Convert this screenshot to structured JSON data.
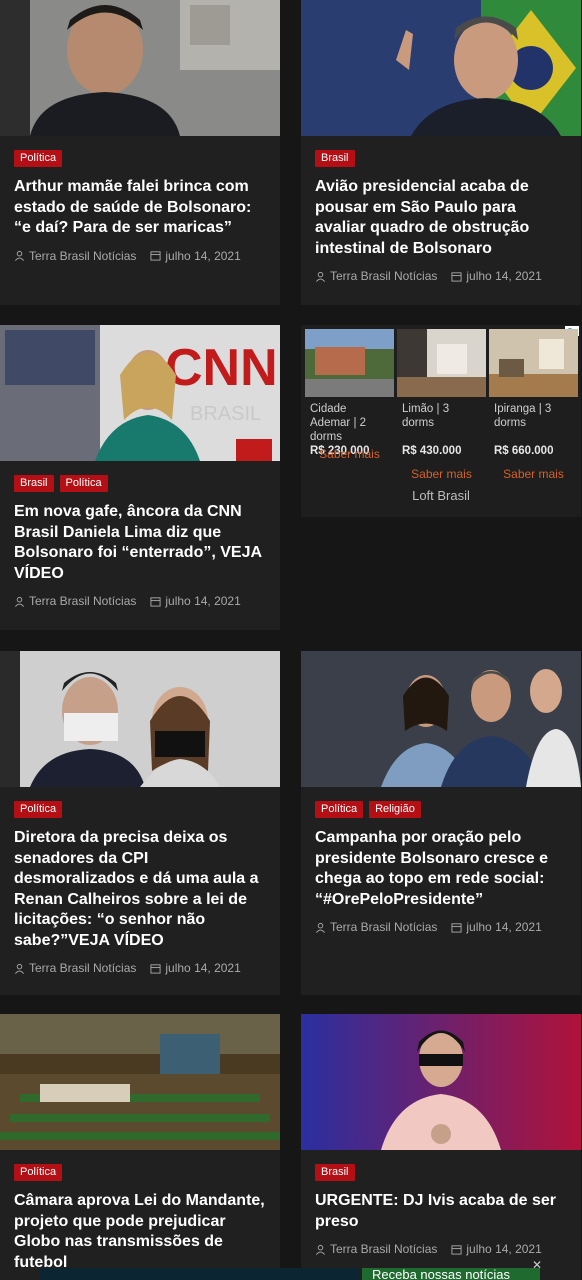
{
  "articles": [
    {
      "categories": [
        "Política"
      ],
      "title": "Arthur mamãe falei brinca com estado de saúde de Bolsonaro: “e daí? Para de ser maricas”",
      "author": "Terra Brasil Notícias",
      "date": "julho 14, 2021"
    },
    {
      "categories": [
        "Brasil"
      ],
      "title": "Avião presidencial acaba de pousar em São Paulo para avaliar quadro de obstrução intestinal de Bolsonaro",
      "author": "Terra Brasil Notícias",
      "date": "julho 14, 2021"
    },
    {
      "categories": [
        "Brasil",
        "Política"
      ],
      "title": "Em nova gafe, âncora da CNN Brasil Daniela Lima diz que Bolsonaro foi “enterrado”, VEJA VÍDEO",
      "author": "Terra Brasil Notícias",
      "date": "julho 14, 2021"
    },
    {
      "categories": [
        "Política"
      ],
      "title": "Diretora da precisa deixa os senadores da CPI desmoralizados e dá uma aula a Renan Calheiros sobre a lei de licitações: “o senhor não sabe?”VEJA VÍDEO",
      "author": "Terra Brasil Notícias",
      "date": "julho 14, 2021"
    },
    {
      "categories": [
        "Política",
        "Religião"
      ],
      "title": "Campanha por oração pelo presidente Bolsonaro cresce e chega ao topo em rede social: “#OrePeloPresidente”",
      "author": "Terra Brasil Notícias",
      "date": "julho 14, 2021"
    },
    {
      "categories": [
        "Política"
      ],
      "title": "Câmara aprova Lei do Mandante, projeto que pode prejudicar Globo nas transmissões de futebol",
      "author": "",
      "date": ""
    },
    {
      "categories": [
        "Brasil"
      ],
      "title": "URGENTE: DJ Ivis acaba de ser preso",
      "author": "Terra Brasil Notícias",
      "date": "julho 14, 2021"
    }
  ],
  "ad": {
    "brand": "Loft Brasil",
    "items": [
      {
        "name": "Cidade Ademar | 2 dorms",
        "price": "R$ 230.000",
        "cta": "Saber mais"
      },
      {
        "name": "Limão | 3 dorms",
        "price": "R$ 430.000",
        "cta": "Saber mais"
      },
      {
        "name": "Ipiranga | 3 dorms",
        "price": "R$ 660.000",
        "cta": "Saber mais"
      }
    ]
  },
  "bottom_banner": {
    "text": "Receba nossas notícias"
  },
  "colors": {
    "category_badge": "#b30f14",
    "ad_cta": "#d2612a",
    "background": "#161616",
    "card": "#202020"
  }
}
